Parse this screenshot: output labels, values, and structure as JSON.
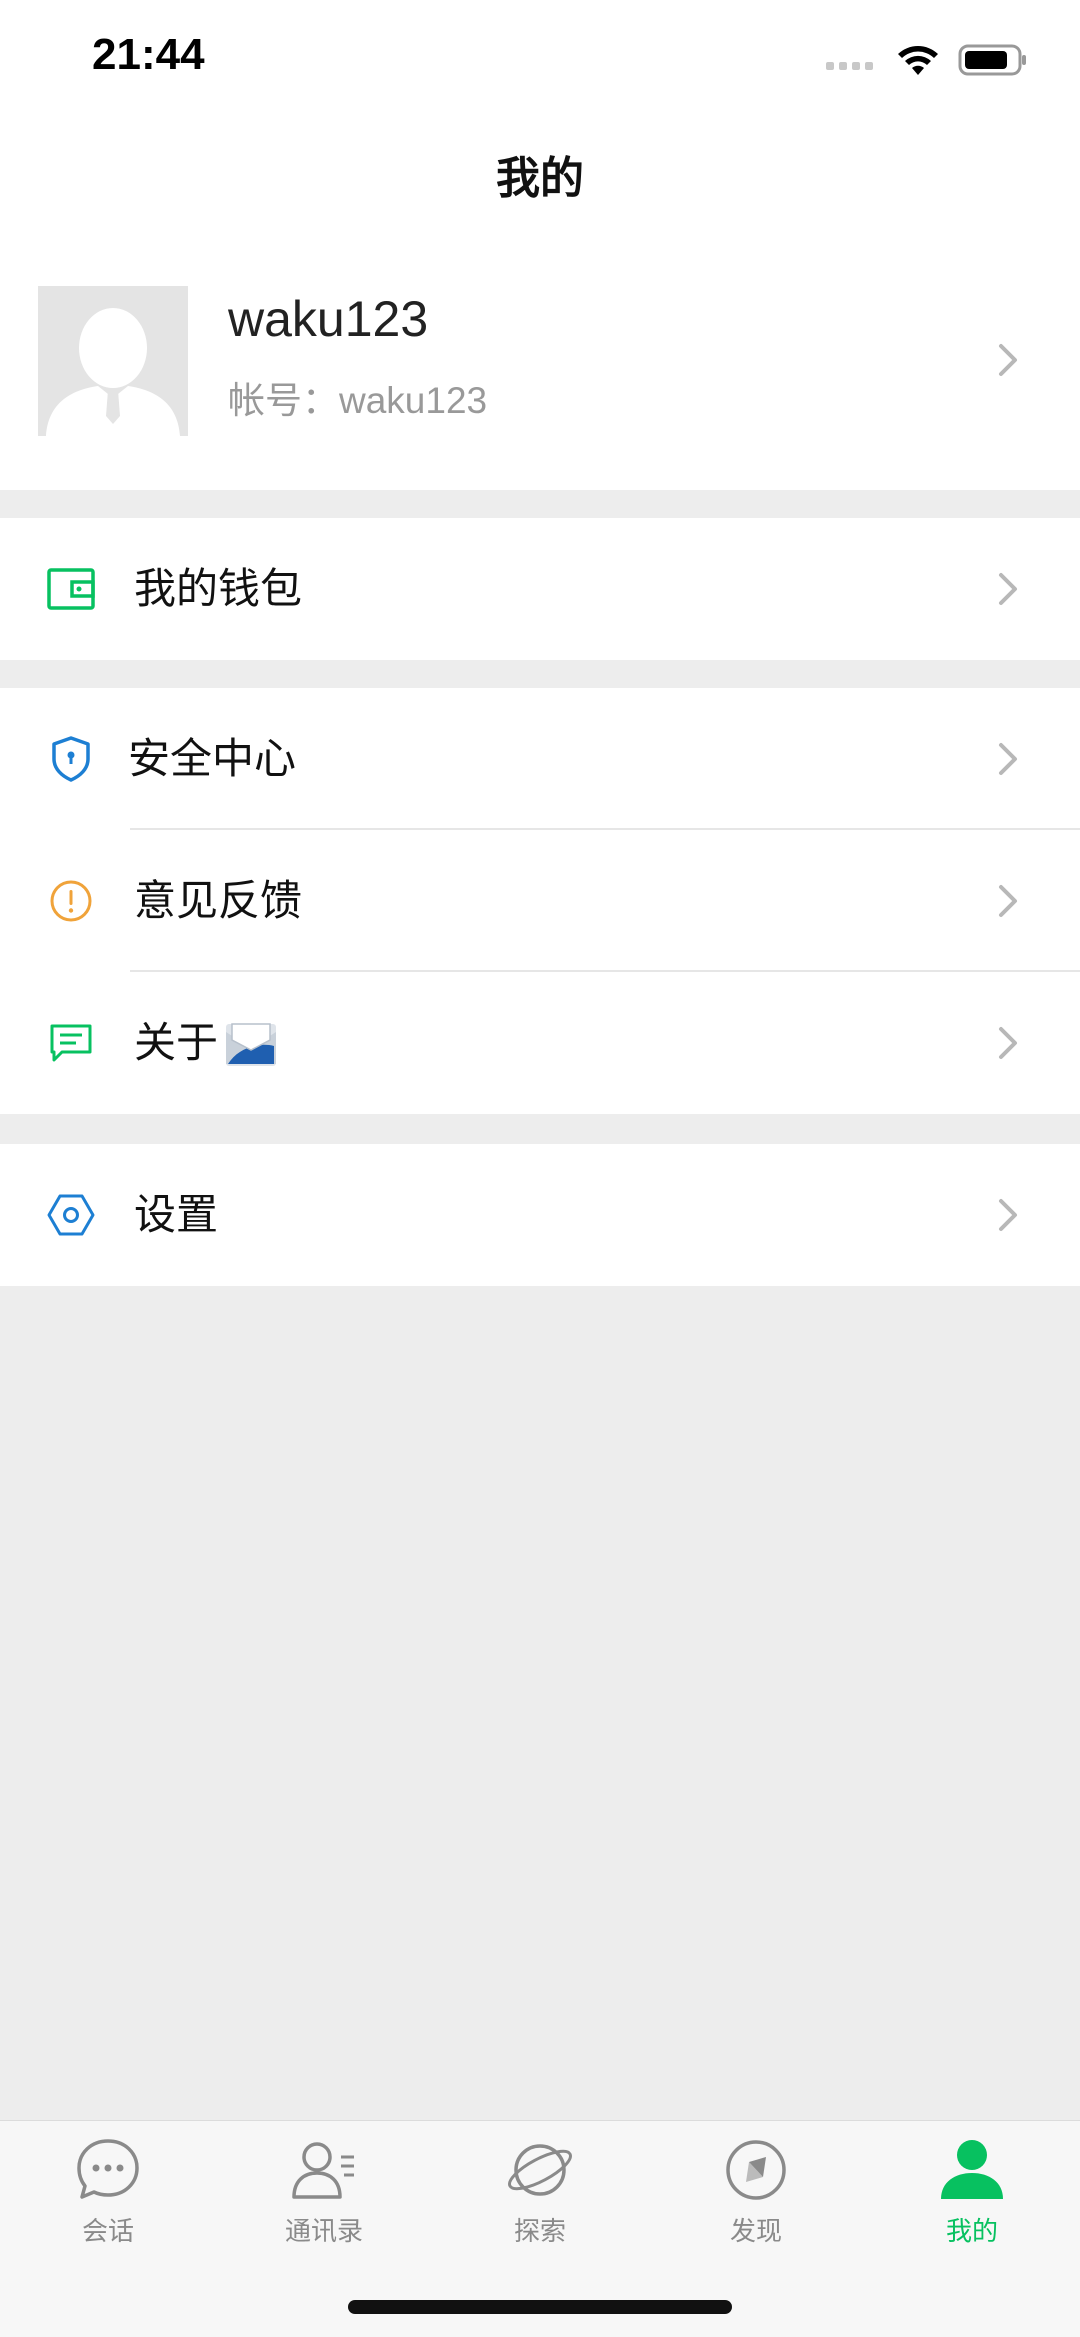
{
  "status_bar": {
    "time": "21:44"
  },
  "nav": {
    "title": "我的"
  },
  "profile": {
    "name": "waku123",
    "account_label": "帐号：",
    "account_value": "waku123"
  },
  "menu": {
    "wallet": "我的钱包",
    "security": "安全中心",
    "feedback": "意见反馈",
    "about": "关于",
    "settings": "设置"
  },
  "tabs": [
    {
      "label": "会话",
      "icon": "chat-bubble-icon"
    },
    {
      "label": "通讯录",
      "icon": "contacts-icon"
    },
    {
      "label": "探索",
      "icon": "planet-icon"
    },
    {
      "label": "发现",
      "icon": "compass-icon"
    },
    {
      "label": "我的",
      "icon": "person-icon",
      "active": true
    }
  ],
  "colors": {
    "accent": "#07c160",
    "security_blue": "#1d7fd3",
    "feedback_orange": "#f0a33a",
    "background": "#ededed"
  }
}
